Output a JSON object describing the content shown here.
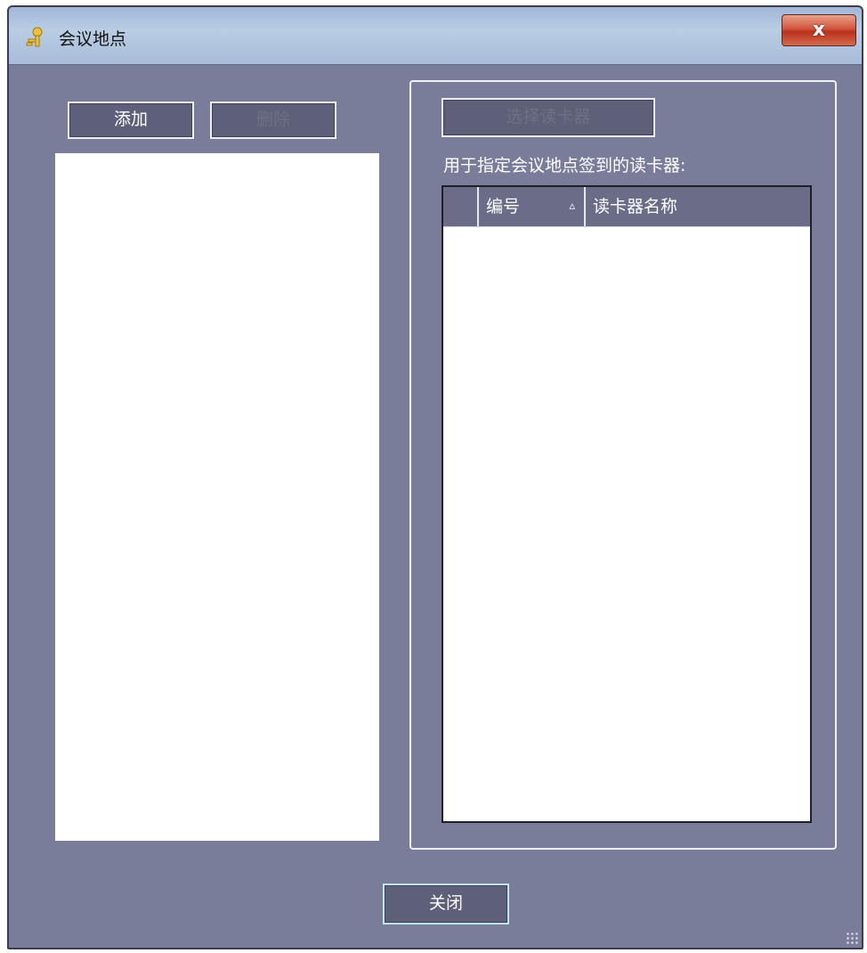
{
  "window": {
    "title": "会议地点",
    "close_label": "x"
  },
  "left": {
    "add_label": "添加",
    "delete_label": "删除"
  },
  "right": {
    "select_reader_label": "选择读卡器",
    "description": "用于指定会议地点签到的读卡器:",
    "table": {
      "columns": [
        "",
        "编号",
        "读卡器名称"
      ],
      "sort_column": "编号",
      "sort_indicator": "▵",
      "rows": []
    }
  },
  "footer": {
    "close_label": "关闭"
  },
  "colors": {
    "window_bg": "#7a7d99",
    "button_bg": "#5e6079",
    "header_bg": "#6a6c88",
    "close_red": "#d4553c"
  }
}
